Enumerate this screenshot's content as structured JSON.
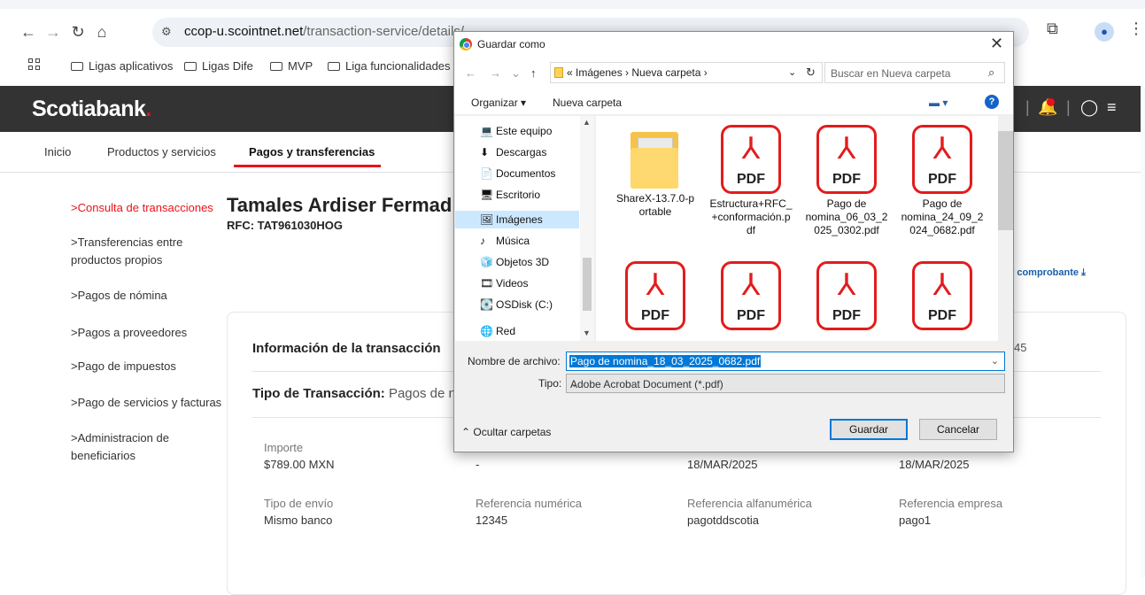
{
  "browser": {
    "url_host": "ccop-u.scointnet.net",
    "url_path": "/transaction-service/details/",
    "bookmarks": [
      "Ligas aplicativos",
      "Ligas Dife",
      "MVP",
      "Liga funcionalidades"
    ]
  },
  "app": {
    "logo": "Scotiabank",
    "logo_dot": ".",
    "nav_tabs": [
      "Inicio",
      "Productos y servicios",
      "Pagos y transferencias"
    ],
    "sidebar": [
      ">Consulta de transacciones",
      ">Transferencias entre productos propios",
      ">Pagos de nómina",
      ">Pagos a proveedores",
      ">Pago de impuestos",
      ">Pago de servicios y facturas",
      ">Administracion de beneficiarios"
    ],
    "client_name": "Tamales Ardiser Fermad",
    "rfc": "RFC: TAT961030HOG",
    "download_label": "r comprobante ⤓",
    "card_title": "Información de la transacción",
    "card_number_fragment": "45",
    "tipo_label": "Tipo de Transacción:",
    "tipo_value": "Pagos de nór",
    "fields": [
      {
        "label": "Importe",
        "value": "$789.00 MXN"
      },
      {
        "label": "",
        "value": "-"
      },
      {
        "label": "",
        "value": "18/MAR/2025"
      },
      {
        "label": "",
        "value": "18/MAR/2025"
      },
      {
        "label": "Tipo de envío",
        "value": "Mismo banco"
      },
      {
        "label": "Referencia numérica",
        "value": "12345"
      },
      {
        "label": "Referencia alfanumérica",
        "value": "pagotddscotia"
      },
      {
        "label": "Referencia empresa",
        "value": "pago1"
      }
    ]
  },
  "dialog": {
    "title": "Guardar como",
    "breadcrumb": "«  Imágenes  ›  Nueva carpeta  ›",
    "search_placeholder": "Buscar en Nueva carpeta",
    "organize": "Organizar ▾",
    "new_folder": "Nueva carpeta",
    "tree": [
      {
        "icon": "💻",
        "label": "Este equipo"
      },
      {
        "icon": "⬇",
        "label": "Descargas"
      },
      {
        "icon": "📄",
        "label": "Documentos"
      },
      {
        "icon": "🖥",
        "label": "Escritorio"
      },
      {
        "icon": "🖼",
        "label": "Imágenes"
      },
      {
        "icon": "♪",
        "label": "Música"
      },
      {
        "icon": "🧊",
        "label": "Objetos 3D"
      },
      {
        "icon": "🎞",
        "label": "Videos"
      },
      {
        "icon": "💽",
        "label": "OSDisk (C:)"
      },
      {
        "icon": "🌐",
        "label": "Red"
      }
    ],
    "files": [
      {
        "type": "folder",
        "name": "ShareX-13.7.0-p\nortable"
      },
      {
        "type": "pdf",
        "name": "Estructura+RFC_\n+conformación.p\ndf"
      },
      {
        "type": "pdf",
        "name": "Pago de\nnomina_06_03_2\n025_0302.pdf"
      },
      {
        "type": "pdf",
        "name": "Pago de\nnomina_24_09_2\n024_0682.pdf"
      },
      {
        "type": "pdf",
        "name": ""
      },
      {
        "type": "pdf",
        "name": ""
      },
      {
        "type": "pdf",
        "name": ""
      },
      {
        "type": "pdf",
        "name": ""
      }
    ],
    "pdf_text": "PDF",
    "filename_label": "Nombre de archivo:",
    "filename_value": "Pago de nomina_18_03_2025_0682.pdf",
    "type_label": "Tipo:",
    "type_value": "Adobe Acrobat Document (*.pdf)",
    "hide_folders": "Ocultar carpetas",
    "save_button": "Guardar",
    "cancel_button": "Cancelar"
  }
}
